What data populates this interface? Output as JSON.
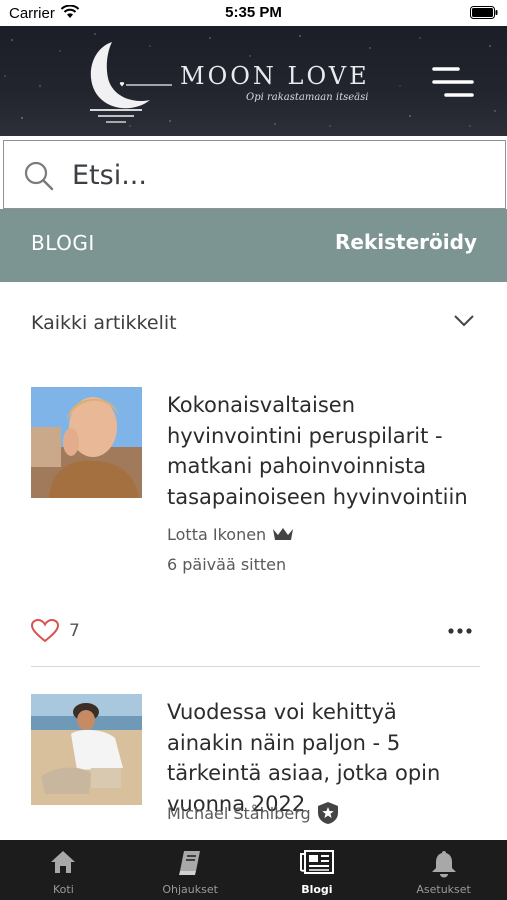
{
  "status_bar": {
    "carrier": "Carrier",
    "time": "5:35 PM"
  },
  "header": {
    "logo_title": "MOON LOVE",
    "logo_tagline": "Opi rakastamaan itseäsi",
    "menu_icon": "hamburger-menu-icon"
  },
  "search": {
    "placeholder": "Etsi..."
  },
  "blog_bar": {
    "title": "BLOGI",
    "register_label": "Rekisteröidy",
    "background": "#7d9592"
  },
  "category": {
    "selected": "Kaikki artikkelit"
  },
  "articles": [
    {
      "title": "Kokonaisvaltaisen hyvinvointini peruspilarit - matkani pahoinvoinnista tasapainoiseen hyvinvointiin",
      "author": "Lotta Ikonen",
      "author_badge": "crown-icon",
      "date": "6 päivää sitten",
      "likes": "7"
    },
    {
      "title": "Vuodessa voi kehittyä ainakin näin paljon - 5 tärkeintä asiaa, jotka opin vuonna 2022",
      "author": "Michael Ståhlberg",
      "author_badge": "shield-star-icon"
    }
  ],
  "tabs": [
    {
      "label": "Koti",
      "icon": "home-icon",
      "active": false
    },
    {
      "label": "Ohjaukset",
      "icon": "book-icon",
      "active": false
    },
    {
      "label": "Blogi",
      "icon": "newspaper-icon",
      "active": true
    },
    {
      "label": "Asetukset",
      "icon": "bell-icon",
      "active": false
    }
  ],
  "colors": {
    "heart": "#d9534f",
    "accent": "#7d9592",
    "tab_bar": "#1c1c1c"
  }
}
